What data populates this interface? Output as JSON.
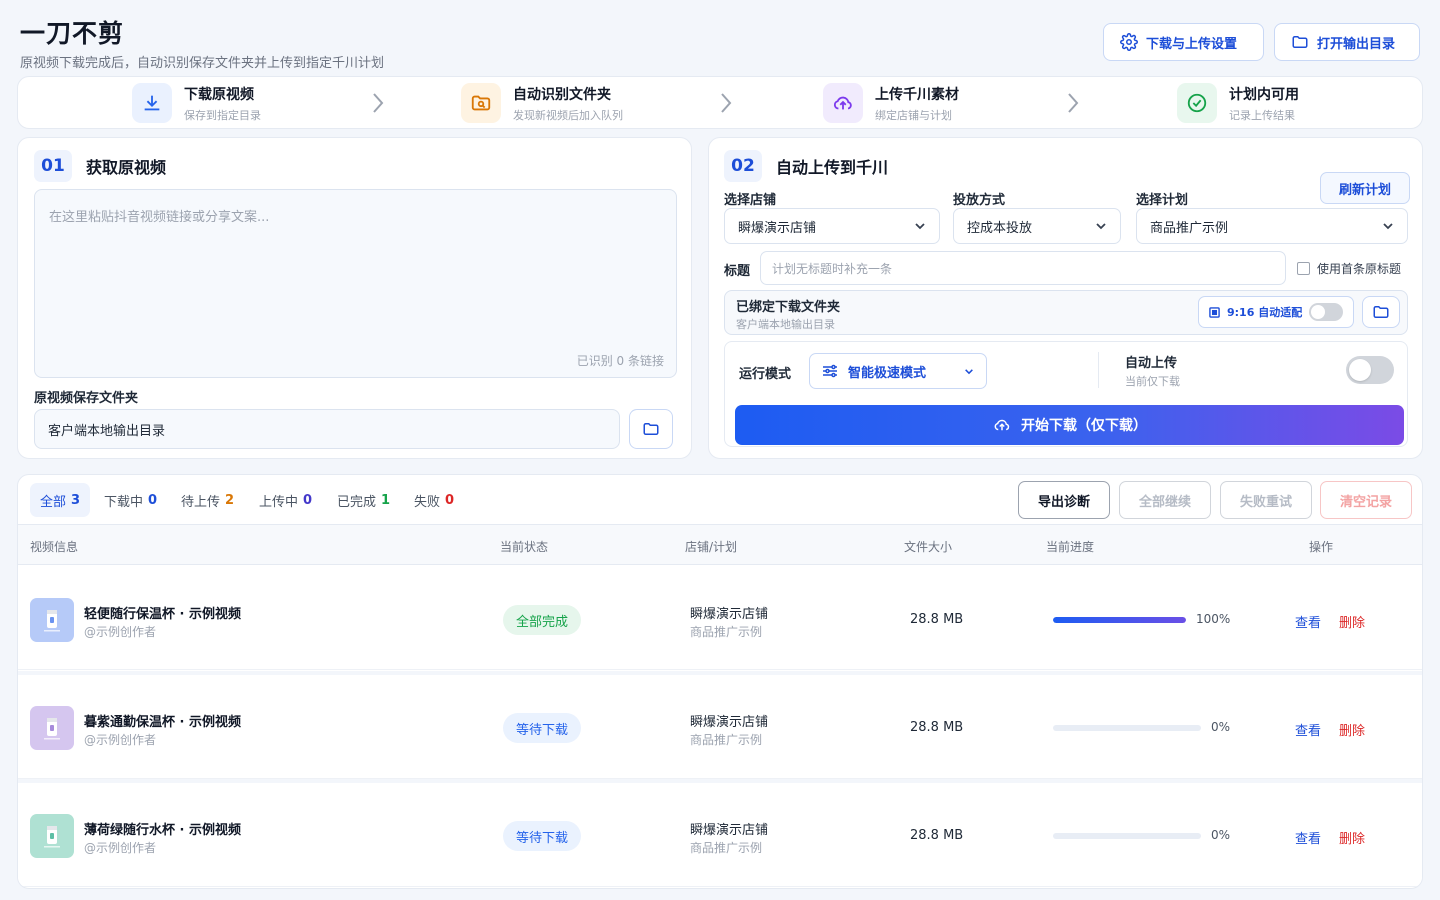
{
  "app": {
    "title": "一刀不剪",
    "subtitle": "原视频下载完成后，自动识别保存文件夹并上传到指定千川计划",
    "settings_label": "下载与上传设置",
    "open_output_label": "打开输出目录"
  },
  "steps": [
    {
      "title": "下载原视频",
      "desc": "保存到指定目录",
      "icon": "download-icon",
      "color": "#2563eb",
      "bg": "#eaf1fe"
    },
    {
      "title": "自动识别文件夹",
      "desc": "发现新视频后加入队列",
      "icon": "folder-search-icon",
      "color": "#d97706",
      "bg": "#fef3e2"
    },
    {
      "title": "上传千川素材",
      "desc": "绑定店铺与计划",
      "icon": "cloud-upload-icon",
      "color": "#7c3aed",
      "bg": "#f1ebfd"
    },
    {
      "title": "计划内可用",
      "desc": "记录上传结果",
      "icon": "check-circle-icon",
      "color": "#16a34a",
      "bg": "#e8f7ee"
    }
  ],
  "left_panel": {
    "num": "01",
    "title": "获取原视频",
    "textarea_placeholder": "在这里粘贴抖音视频链接或分享文案...",
    "link_count": "已识别 0 条链接",
    "folder_label": "原视频保存文件夹",
    "folder_value": "客户端本地输出目录"
  },
  "right_panel": {
    "num": "02",
    "title": "自动上传到千川",
    "shop_label": "选择店铺",
    "shop_value": "瞬爆演示店铺",
    "delivery_label": "投放方式",
    "delivery_value": "控成本投放",
    "plan_label": "选择计划",
    "plan_value": "商品推广示例",
    "refresh_label": "刷新计划",
    "title_label": "标题",
    "title_placeholder": "计划无标题时补充一条",
    "use_first_title": "使用首条原标题",
    "bound_folder_title": "已绑定下载文件夹",
    "bound_folder_desc": "客户端本地输出目录",
    "ratio_label": "9:16 自动适配",
    "run_mode_label": "运行模式",
    "run_mode_value": "智能极速模式",
    "auto_upload_title": "自动上传",
    "auto_upload_desc": "当前仅下载",
    "start_label": "开始下载（仅下载）"
  },
  "filters": [
    {
      "label": "全部",
      "count": "3",
      "color": "#1d4ed8"
    },
    {
      "label": "下载中",
      "count": "0",
      "color": "#1d4ed8"
    },
    {
      "label": "待上传",
      "count": "2",
      "color": "#d97706"
    },
    {
      "label": "上传中",
      "count": "0",
      "color": "#4338ca"
    },
    {
      "label": "已完成",
      "count": "1",
      "color": "#16a34a"
    },
    {
      "label": "失败",
      "count": "0",
      "color": "#dc2626"
    }
  ],
  "actions": {
    "export": "导出诊断",
    "continue_all": "全部继续",
    "retry_failed": "失败重试",
    "clear": "清空记录"
  },
  "columns": [
    "视频信息",
    "当前状态",
    "店铺/计划",
    "文件大小",
    "当前进度",
    "操作"
  ],
  "rows": [
    {
      "title": "轻便随行保温杯 · 示例视频",
      "author": "@示例创作者",
      "status": "全部完成",
      "status_kind": "done",
      "shop": "瞬爆演示店铺",
      "plan": "商品推广示例",
      "size": "28.8 MB",
      "progress": 100,
      "progress_text": "100%",
      "view": "查看",
      "delete": "删除",
      "thumb_color": "#6b93f0",
      "thumb_bg": "#dbe6fd"
    },
    {
      "title": "暮紫通勤保温杯 · 示例视频",
      "author": "@示例创作者",
      "status": "等待下载",
      "status_kind": "wait",
      "shop": "瞬爆演示店铺",
      "plan": "商品推广示例",
      "size": "28.8 MB",
      "progress": 0,
      "progress_text": "0%",
      "view": "查看",
      "delete": "删除",
      "thumb_color": "#a78bdb",
      "thumb_bg": "#ece4fa"
    },
    {
      "title": "薄荷绿随行水杯 · 示例视频",
      "author": "@示例创作者",
      "status": "等待下载",
      "status_kind": "wait",
      "shop": "瞬爆演示店铺",
      "plan": "商品推广示例",
      "size": "28.8 MB",
      "progress": 0,
      "progress_text": "0%",
      "view": "查看",
      "delete": "删除",
      "thumb_color": "#5dbfa5",
      "thumb_bg": "#d9f2ea"
    }
  ]
}
